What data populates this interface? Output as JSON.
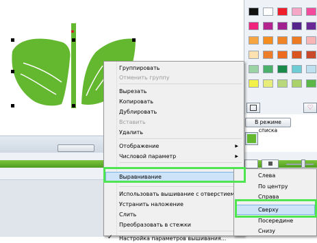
{
  "palette": {
    "colors": [
      [
        "#111111",
        "#ffffff",
        "#ee1f2b",
        "#f7a7c6",
        "#f34b9b"
      ],
      [
        "#f0247c",
        "#b4238e",
        "#a0208f",
        "#55238c",
        "#6a2897"
      ],
      [
        "#f6a540",
        "#f58d1e",
        "#f08527",
        "#ee7b21",
        "#f7b5b5"
      ],
      [
        "#fde1b0",
        "#ee7d2a",
        "#ec6d1f",
        "#d9541f",
        "#c84a2a"
      ],
      [
        "#9bd3a4",
        "#4ab06a",
        "#1a8a4b",
        "#6ecdd4",
        "#bfe1ef"
      ],
      [
        "#f4f04a",
        "#e8ec7a",
        "#b9d77b",
        "#a9d36a",
        "#5bb747"
      ]
    ],
    "list_mode_label": "В режиме списка",
    "accent": "#64b830"
  },
  "context_menu": {
    "items": [
      {
        "label": "Группировать",
        "disabled": false
      },
      {
        "label": "Отменить группу",
        "disabled": true
      },
      {
        "label": "Вырезать",
        "disabled": false
      },
      {
        "label": "Копировать",
        "disabled": false
      },
      {
        "label": "Дублировать",
        "disabled": false
      },
      {
        "label": "Вставить",
        "disabled": true
      },
      {
        "label": "Удалить",
        "disabled": false
      },
      {
        "label": "Отображение",
        "disabled": false,
        "submenu": true
      },
      {
        "label": "Числовой параметр",
        "disabled": false,
        "submenu": true
      },
      {
        "label": "Выравнивание",
        "disabled": false,
        "submenu": true,
        "highlighted": true
      },
      {
        "label": "Использовать вышивание с отверстием",
        "disabled": false
      },
      {
        "label": "Устранить наложение",
        "disabled": false
      },
      {
        "label": "Слить",
        "disabled": false
      },
      {
        "label": "Преобразовать в стежки",
        "disabled": false
      },
      {
        "label": "Настройка параметров вышивания...",
        "disabled": false,
        "checked": true
      }
    ]
  },
  "align_submenu": {
    "items": [
      "Слева",
      "По центру",
      "Справа",
      "Сверху",
      "Посередине",
      "Снизу"
    ],
    "highlighted": "Сверху"
  },
  "highlight_color": "#4ee64e",
  "leaf_color": "#64b830"
}
